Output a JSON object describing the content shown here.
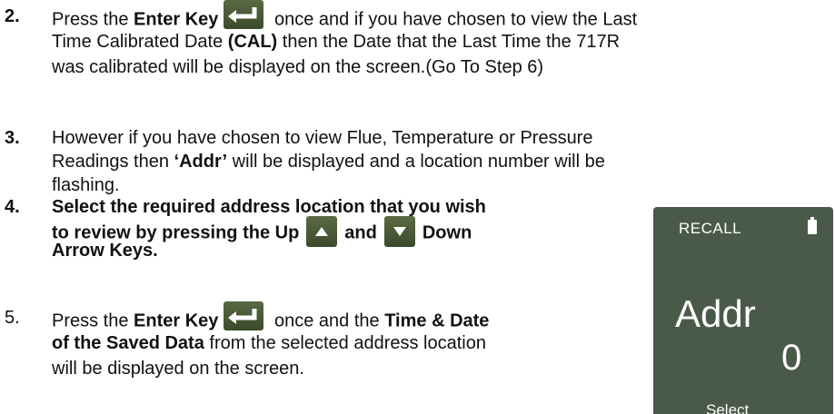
{
  "steps": [
    {
      "number": "2.",
      "lines": [
        [
          "Press the ",
          "Enter Key",
          " once and if you have chosen to view the Last"
        ],
        [
          "Time Calibrated Date ",
          "(CAL)",
          " then the Date that the Last Time the 717R"
        ],
        [
          "was calibrated will be displayed on the screen.(Go To Step 6)"
        ]
      ]
    },
    {
      "number": "3.",
      "lines": [
        [
          "However if you have chosen to view Flue, Temperature or Pressure"
        ],
        [
          "Readings then ",
          "‘Addr’",
          " will be displayed and a location number will be"
        ],
        [
          "flashing."
        ]
      ]
    },
    {
      "number": "4.",
      "lines": [
        [
          "Select the required address location that you wish"
        ],
        [
          "to review by pressing the Up",
          "and",
          "Down"
        ],
        [
          "Arrow Keys."
        ]
      ]
    },
    {
      "number": "5.",
      "lines": [
        [
          "Press the ",
          "Enter Key",
          " once and the ",
          "Time & Date"
        ],
        [
          "of the Saved Data",
          " from the selected address location"
        ],
        [
          "will be displayed on the screen."
        ]
      ]
    }
  ],
  "display": {
    "mode": "RECALL",
    "label": "Addr",
    "value": "0",
    "softkey": "Select"
  },
  "icons": {
    "enter_key": "enter-return-key-icon",
    "up_key": "up-arrow-key-icon",
    "down_key": "down-arrow-key-icon",
    "battery": "battery-icon"
  },
  "colors": {
    "key": "#4a5a36",
    "display_bg": "#4a5a48",
    "text": "#111111"
  }
}
